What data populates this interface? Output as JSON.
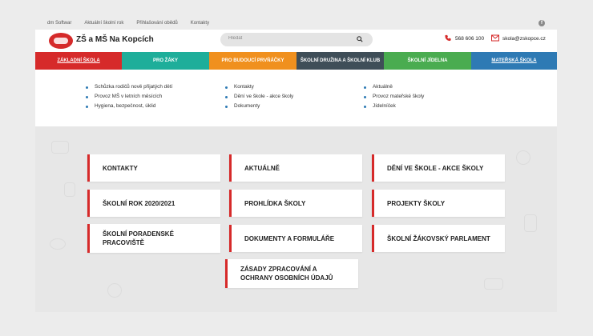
{
  "topbar": {
    "links": [
      "dm Softwar",
      "Aktuální školní rok",
      "Přihlašování obědů",
      "Kontakty"
    ],
    "social_icon": "facebook-icon"
  },
  "header": {
    "brand": "ZŠ a MŠ Na Kopcích",
    "search_placeholder": "Hledat",
    "phone": "568 606 100",
    "email": "skola@zskopce.cz"
  },
  "nav": {
    "items": [
      {
        "label": "Základní škola",
        "color": "#d62a2a"
      },
      {
        "label": "Pro žáky",
        "color": "#1eae9a"
      },
      {
        "label": "Pro budoucí prvňáčky",
        "color": "#f0901e"
      },
      {
        "label": "Školní družina a školní klub",
        "color": "#3f4e58"
      },
      {
        "label": "Školní jídelna",
        "color": "#4aac50"
      },
      {
        "label": "Mateřská škola",
        "color": "#2e7ab4"
      }
    ]
  },
  "submenu": {
    "col1": [
      "Schůzka rodičů nově přijatých dětí",
      "Provoz MŠ v letních měsících",
      "Hygiena, bezpečnost, úklid"
    ],
    "col2": [
      "Kontakty",
      "Dění ve škole - akce školy",
      "Dokumenty"
    ],
    "col3": [
      "Aktuálně",
      "Provoz mateřské školy",
      "Jídelníček"
    ]
  },
  "cards": [
    "KONTAKTY",
    "AKTUÁLNĚ",
    "DĚNÍ VE ŠKOLE - AKCE ŠKOLY",
    "ŠKOLNÍ ROK 2020/2021",
    "PROHLÍDKA ŠKOLY",
    "PROJEKTY ŠKOLY",
    "ŠKOLNÍ PORADENSKÉ PRACOVIŠTĚ",
    "DOKUMENTY A FORMULÁŘE",
    "ŠKOLNÍ ŽÁKOVSKÝ PARLAMENT",
    "ZÁSADY ZPRACOVÁNÍ A OCHRANY OSOBNÍCH ÚDAJŮ"
  ],
  "colors": {
    "accent_red": "#d62a2a",
    "accent_blue": "#2e7ab4"
  }
}
